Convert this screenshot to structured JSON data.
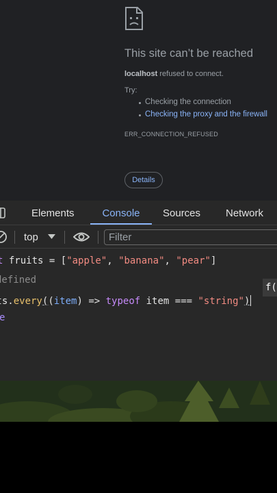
{
  "error_page": {
    "title": "This site can’t be reached",
    "host": "localhost",
    "message_rest": " refused to connect.",
    "try_label": "Try:",
    "suggestions": [
      "Checking the connection",
      "Checking the proxy and the firewall"
    ],
    "error_code": "ERR_CONNECTION_REFUSED",
    "details_button": "Details"
  },
  "devtools": {
    "tabs": [
      "Elements",
      "Console",
      "Sources",
      "Network"
    ],
    "active_tab": "Console",
    "context": "top",
    "filter_placeholder": "Filter",
    "console": {
      "line1": {
        "kw": "t",
        "name": " fruits",
        "eq": " = ",
        "open": "[",
        "s1": "\"apple\"",
        "c1": ", ",
        "s2": "\"banana\"",
        "c2": ", ",
        "s3": "\"pear\"",
        "close": "]"
      },
      "result": "defined",
      "line2": {
        "obj": "its.",
        "method": "every",
        "open": "(",
        "param_open": "(",
        "param": "item",
        "param_close": ")",
        "arrow": " => ",
        "kw": "typeof",
        "rest": " item === ",
        "str": "\"string\"",
        "close": ")"
      },
      "prompt": "e",
      "autocomplete": "f(p"
    }
  },
  "colors": {
    "accent": "#8ab4f8",
    "keyword": "#c58af9",
    "string": "#f28b82",
    "function": "#e8c06b",
    "param": "#7cacf8"
  }
}
